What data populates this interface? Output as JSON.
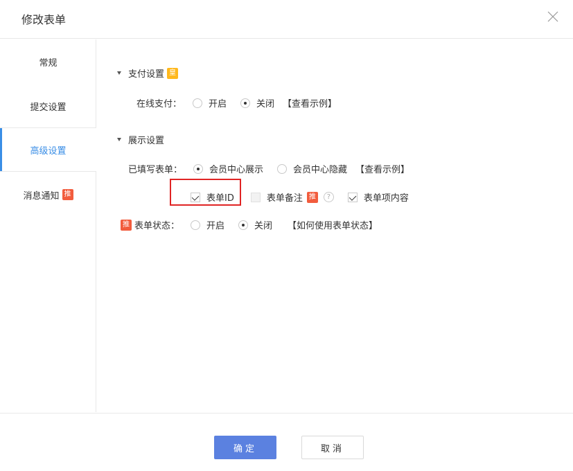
{
  "dialog": {
    "title": "修改表单"
  },
  "sidebar": {
    "items": [
      {
        "label": "常规"
      },
      {
        "label": "提交设置"
      },
      {
        "label": "高级设置"
      },
      {
        "label": "消息通知",
        "badge": "推"
      }
    ]
  },
  "payment": {
    "section_title": "支付设置",
    "section_badge": "皇",
    "online_label": "在线支付：",
    "option_on": "开启",
    "option_off": "关闭",
    "selected": "关闭",
    "example_link": "【查看示例】"
  },
  "display": {
    "section_title": "展示设置",
    "filled_label": "已填写表单：",
    "option_show": "会员中心展示",
    "option_hide": "会员中心隐藏",
    "selected": "会员中心展示",
    "example_link": "【查看示例】",
    "checkboxes": [
      {
        "label": "表单ID",
        "checked": true
      },
      {
        "label": "表单备注",
        "checked": false,
        "badge": "推"
      },
      {
        "label": "表单项内容",
        "checked": true
      }
    ],
    "status_badge": "推",
    "status_label": "表单状态：",
    "status_on": "开启",
    "status_off": "关闭",
    "status_selected": "关闭",
    "status_help_link": "【如何使用表单状态】"
  },
  "footer": {
    "confirm_label": "确定",
    "cancel_label": "取消"
  },
  "colors": {
    "primary": "#5b81e0",
    "active_nav": "#3a8ee6",
    "badge_red": "#f25c3d",
    "badge_yellow": "#ffb81c",
    "highlight": "#e02424"
  }
}
